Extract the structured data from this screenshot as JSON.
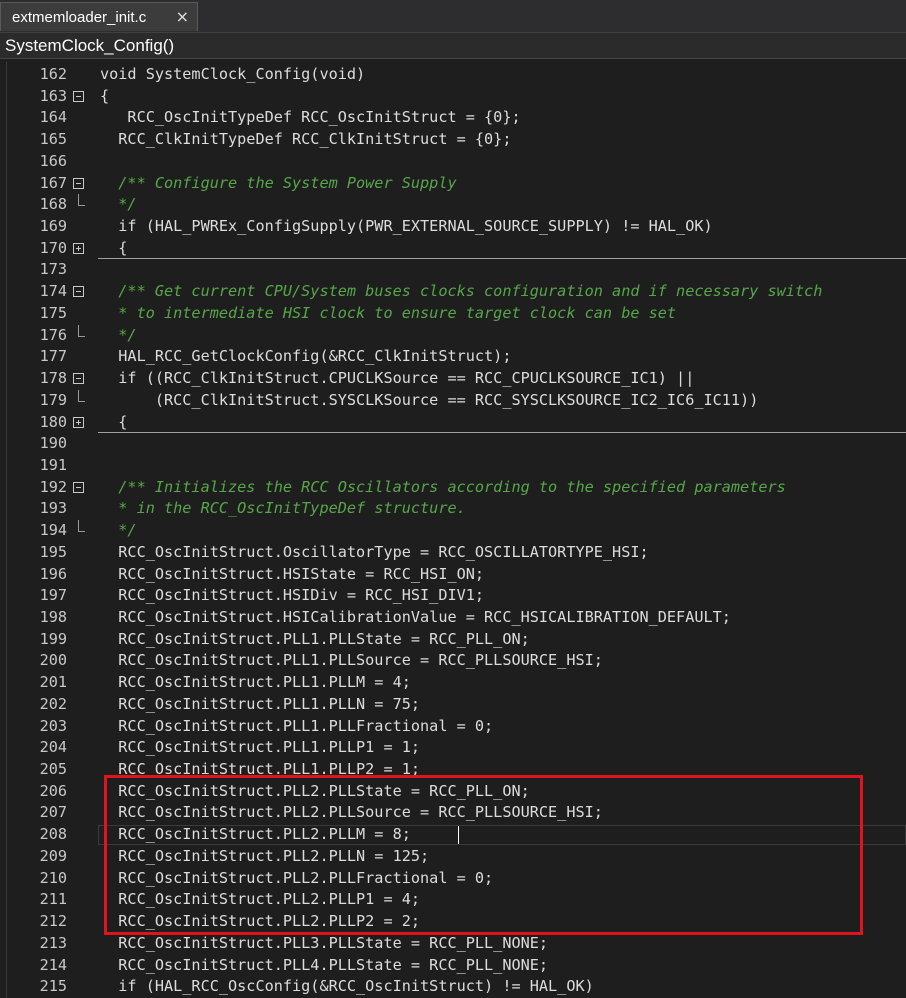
{
  "tab": {
    "filename": "extmemloader_init.c",
    "close_glyph": "×"
  },
  "function_bar": {
    "current_function": "SystemClock_Config()"
  },
  "editor": {
    "lines": [
      {
        "num": "162",
        "fold": "",
        "text": "void SystemClock_Config(void)",
        "kind": "code"
      },
      {
        "num": "163",
        "fold": "minus",
        "text": "{",
        "kind": "code"
      },
      {
        "num": "164",
        "fold": "line",
        "text": "   RCC_OscInitTypeDef RCC_OscInitStruct = {0};",
        "kind": "code"
      },
      {
        "num": "165",
        "fold": "line",
        "text": "  RCC_ClkInitTypeDef RCC_ClkInitStruct = {0};",
        "kind": "code"
      },
      {
        "num": "166",
        "fold": "line",
        "text": "",
        "kind": "code"
      },
      {
        "num": "167",
        "fold": "minus",
        "text": "  /** Configure the System Power Supply",
        "kind": "comment"
      },
      {
        "num": "168",
        "fold": "end",
        "text": "  */",
        "kind": "comment"
      },
      {
        "num": "169",
        "fold": "line",
        "text": "  if (HAL_PWREx_ConfigSupply(PWR_EXTERNAL_SOURCE_SUPPLY) != HAL_OK)",
        "kind": "code"
      },
      {
        "num": "170",
        "fold": "plus",
        "text": "  {",
        "kind": "code"
      },
      {
        "num": "173",
        "fold": "line",
        "text": "",
        "kind": "code"
      },
      {
        "num": "174",
        "fold": "minus",
        "text": "  /** Get current CPU/System buses clocks configuration and if necessary switch",
        "kind": "comment"
      },
      {
        "num": "175",
        "fold": "line",
        "text": "  * to intermediate HSI clock to ensure target clock can be set",
        "kind": "comment"
      },
      {
        "num": "176",
        "fold": "end",
        "text": "  */",
        "kind": "comment"
      },
      {
        "num": "177",
        "fold": "line",
        "text": "  HAL_RCC_GetClockConfig(&RCC_ClkInitStruct);",
        "kind": "code"
      },
      {
        "num": "178",
        "fold": "minus",
        "text": "  if ((RCC_ClkInitStruct.CPUCLKSource == RCC_CPUCLKSOURCE_IC1) ||",
        "kind": "code"
      },
      {
        "num": "179",
        "fold": "end",
        "text": "      (RCC_ClkInitStruct.SYSCLKSource == RCC_SYSCLKSOURCE_IC2_IC6_IC11))",
        "kind": "code"
      },
      {
        "num": "180",
        "fold": "plus",
        "text": "  {",
        "kind": "code"
      },
      {
        "num": "190",
        "fold": "line",
        "text": "",
        "kind": "code"
      },
      {
        "num": "191",
        "fold": "line",
        "text": "",
        "kind": "code"
      },
      {
        "num": "192",
        "fold": "minus",
        "text": "  /** Initializes the RCC Oscillators according to the specified parameters",
        "kind": "comment"
      },
      {
        "num": "193",
        "fold": "line",
        "text": "  * in the RCC_OscInitTypeDef structure.",
        "kind": "comment"
      },
      {
        "num": "194",
        "fold": "end",
        "text": "  */",
        "kind": "comment"
      },
      {
        "num": "195",
        "fold": "line",
        "text": "  RCC_OscInitStruct.OscillatorType = RCC_OSCILLATORTYPE_HSI;",
        "kind": "code"
      },
      {
        "num": "196",
        "fold": "line",
        "text": "  RCC_OscInitStruct.HSIState = RCC_HSI_ON;",
        "kind": "code"
      },
      {
        "num": "197",
        "fold": "line",
        "text": "  RCC_OscInitStruct.HSIDiv = RCC_HSI_DIV1;",
        "kind": "code"
      },
      {
        "num": "198",
        "fold": "line",
        "text": "  RCC_OscInitStruct.HSICalibrationValue = RCC_HSICALIBRATION_DEFAULT;",
        "kind": "code"
      },
      {
        "num": "199",
        "fold": "line",
        "text": "  RCC_OscInitStruct.PLL1.PLLState = RCC_PLL_ON;",
        "kind": "code"
      },
      {
        "num": "200",
        "fold": "line",
        "text": "  RCC_OscInitStruct.PLL1.PLLSource = RCC_PLLSOURCE_HSI;",
        "kind": "code"
      },
      {
        "num": "201",
        "fold": "line",
        "text": "  RCC_OscInitStruct.PLL1.PLLM = 4;",
        "kind": "code"
      },
      {
        "num": "202",
        "fold": "line",
        "text": "  RCC_OscInitStruct.PLL1.PLLN = 75;",
        "kind": "code"
      },
      {
        "num": "203",
        "fold": "line",
        "text": "  RCC_OscInitStruct.PLL1.PLLFractional = 0;",
        "kind": "code"
      },
      {
        "num": "204",
        "fold": "line",
        "text": "  RCC_OscInitStruct.PLL1.PLLP1 = 1;",
        "kind": "code"
      },
      {
        "num": "205",
        "fold": "line",
        "text": "  RCC_OscInitStruct.PLL1.PLLP2 = 1;",
        "kind": "code"
      },
      {
        "num": "206",
        "fold": "line",
        "text": "  RCC_OscInitStruct.PLL2.PLLState = RCC_PLL_ON;",
        "kind": "code"
      },
      {
        "num": "207",
        "fold": "line",
        "text": "  RCC_OscInitStruct.PLL2.PLLSource = RCC_PLLSOURCE_HSI;",
        "kind": "code"
      },
      {
        "num": "208",
        "fold": "line",
        "text": "  RCC_OscInitStruct.PLL2.PLLM = 8;",
        "kind": "code"
      },
      {
        "num": "209",
        "fold": "line",
        "text": "  RCC_OscInitStruct.PLL2.PLLN = 125;",
        "kind": "code"
      },
      {
        "num": "210",
        "fold": "line",
        "text": "  RCC_OscInitStruct.PLL2.PLLFractional = 0;",
        "kind": "code"
      },
      {
        "num": "211",
        "fold": "line",
        "text": "  RCC_OscInitStruct.PLL2.PLLP1 = 4;",
        "kind": "code"
      },
      {
        "num": "212",
        "fold": "line",
        "text": "  RCC_OscInitStruct.PLL2.PLLP2 = 2;",
        "kind": "code"
      },
      {
        "num": "213",
        "fold": "line",
        "text": "  RCC_OscInitStruct.PLL3.PLLState = RCC_PLL_NONE;",
        "kind": "code"
      },
      {
        "num": "214",
        "fold": "line",
        "text": "  RCC_OscInitStruct.PLL4.PLLState = RCC_PLL_NONE;",
        "kind": "code"
      },
      {
        "num": "215",
        "fold": "line",
        "text": "  if (HAL_RCC_OscConfig(&RCC_OscInitStruct) != HAL_OK)",
        "kind": "code"
      }
    ]
  },
  "annotation": {
    "highlight_color": "#e0141c"
  },
  "colors": {
    "background": "#1e1e1e",
    "comment": "#57a64a",
    "code": "#dcdcdc",
    "line_number": "#c8c8c8"
  }
}
